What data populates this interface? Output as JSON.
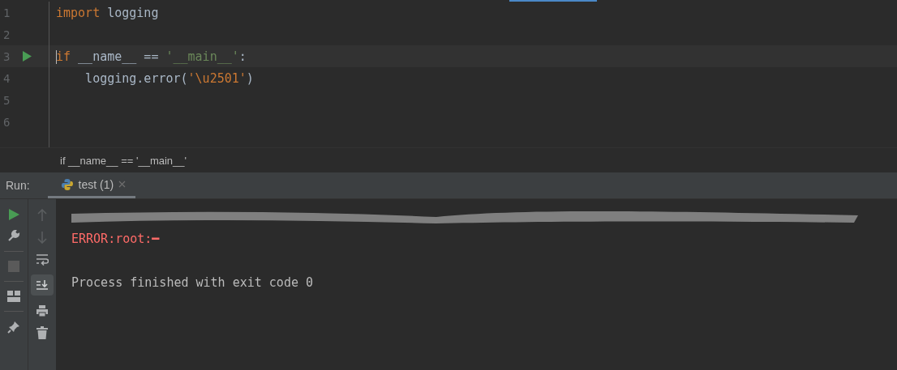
{
  "editor": {
    "lines": [
      {
        "number": "1",
        "current": false,
        "run_marker": false,
        "tokens": [
          {
            "kind": "keyword",
            "text": "import"
          },
          {
            "kind": "plain",
            "text": " logging"
          }
        ]
      },
      {
        "number": "2",
        "current": false,
        "run_marker": false
      },
      {
        "number": "3",
        "current": true,
        "run_marker": true,
        "tokens": [
          {
            "kind": "keyword",
            "text": "if"
          },
          {
            "kind": "plain",
            "text": " __name__ == "
          },
          {
            "kind": "string",
            "text": "'__main__'"
          },
          {
            "kind": "plain",
            "text": ":"
          }
        ]
      },
      {
        "number": "4",
        "current": false,
        "run_marker": false,
        "tokens": [
          {
            "kind": "plain",
            "text": "    logging.error("
          },
          {
            "kind": "escape_string",
            "text": "'\\u2501'"
          },
          {
            "kind": "plain",
            "text": ")"
          }
        ]
      },
      {
        "number": "5",
        "current": false,
        "run_marker": false
      },
      {
        "number": "6",
        "current": false,
        "run_marker": false
      }
    ]
  },
  "breadcrumb": "if __name__ == '__main__'",
  "run_panel": {
    "label": "Run:",
    "tabs": [
      {
        "title": "test (1)",
        "selected": true
      }
    ],
    "console": [
      {
        "kind": "redacted"
      },
      {
        "kind": "error",
        "text": "ERROR:root:━"
      },
      {
        "kind": "blank"
      },
      {
        "kind": "normal",
        "text": "Process finished with exit code 0"
      }
    ]
  }
}
